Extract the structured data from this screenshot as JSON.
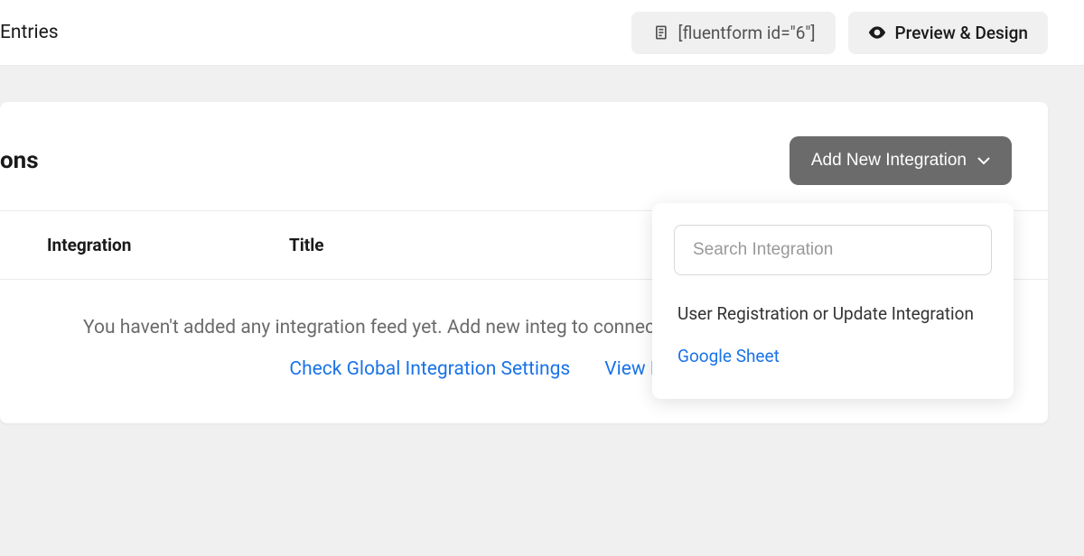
{
  "topbar": {
    "tab_label": "Entries",
    "shortcode": "[fluentform id=\"6\"]",
    "preview_label": "Preview & Design"
  },
  "panel": {
    "title": "ons",
    "add_button_label": "Add New Integration"
  },
  "table": {
    "col_integration": "Integration",
    "col_title": "Title"
  },
  "empty": {
    "message": "You haven't added any integration feed yet. Add new integ to connect your favourite tools with your forms",
    "link_global": "Check Global Integration Settings",
    "link_docs": "View Documentati"
  },
  "dropdown": {
    "search_placeholder": "Search Integration",
    "items": [
      {
        "label": "User Registration or Update Integration",
        "highlighted": false
      },
      {
        "label": "Google Sheet",
        "highlighted": true
      }
    ]
  }
}
